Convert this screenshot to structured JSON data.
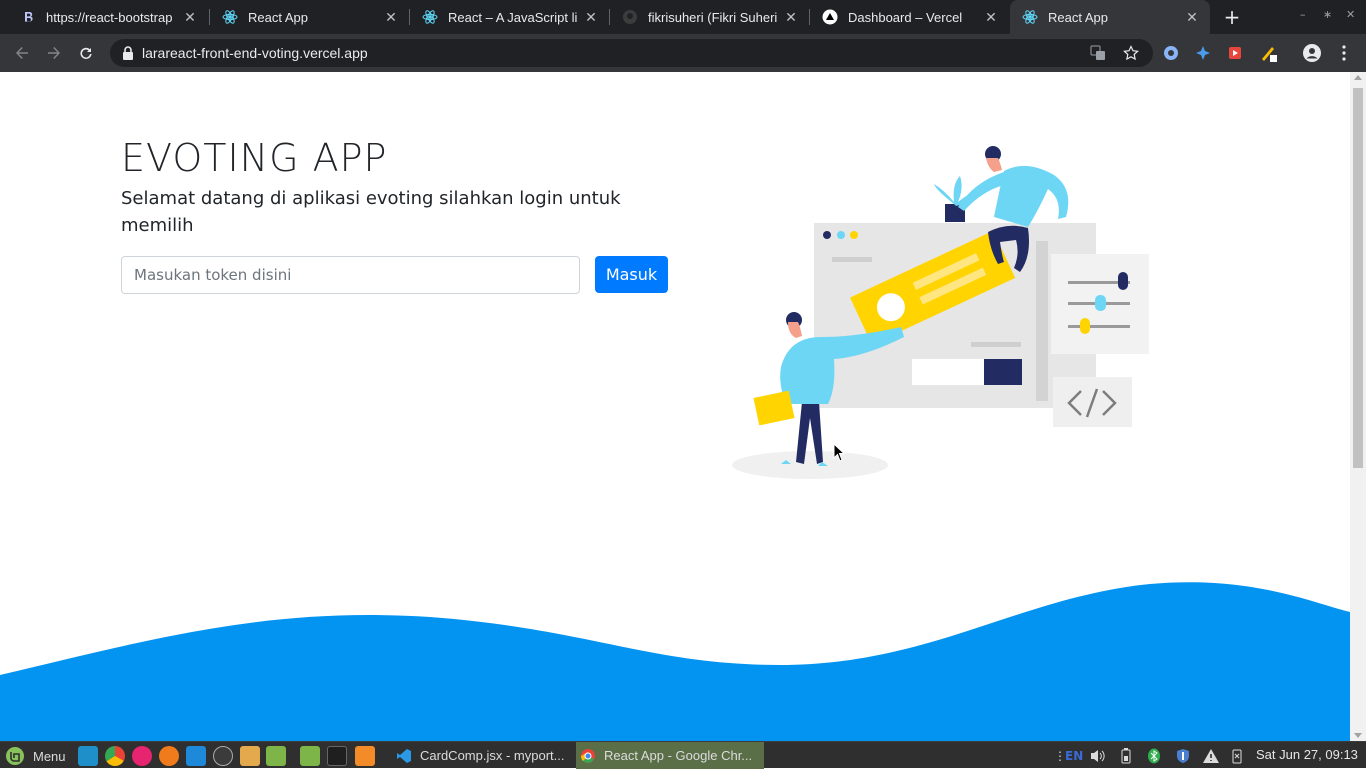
{
  "browser": {
    "tabs": [
      {
        "label": "https://react-bootstrap",
        "icon": "bootstrap-icon",
        "active": false
      },
      {
        "label": "React App",
        "icon": "react-icon",
        "active": false
      },
      {
        "label": "React – A JavaScript lib",
        "icon": "react-icon",
        "active": false
      },
      {
        "label": "fikrisuheri (Fikri Suheri)",
        "icon": "github-icon",
        "active": false
      },
      {
        "label": "Dashboard – Vercel",
        "icon": "vercel-icon",
        "active": false
      },
      {
        "label": "React App",
        "icon": "react-icon",
        "active": true
      }
    ],
    "url": "larareact-front-end-voting.vercel.app"
  },
  "page": {
    "title": "EVOTING APP",
    "subtitle": "Selamat datang di aplikasi evoting silahkan login untuk memilih",
    "token_placeholder": "Masukan token disini",
    "token_value": "",
    "submit_label": "Masuk"
  },
  "colors": {
    "primary": "#007bff",
    "wave": "#0394f2",
    "illustration_yellow": "#ffd400",
    "illustration_blue": "#6dd6f5",
    "illustration_navy": "#232b63"
  },
  "taskbar": {
    "menu_label": "Menu",
    "windows": [
      {
        "label": "CardComp.jsx - myport...",
        "icon": "vscode-icon",
        "active": false
      },
      {
        "label": "React App - Google Chr...",
        "icon": "chrome-icon",
        "active": true
      }
    ],
    "keyboard_layout": "EN",
    "clock": "Sat Jun 27, 09:13"
  }
}
